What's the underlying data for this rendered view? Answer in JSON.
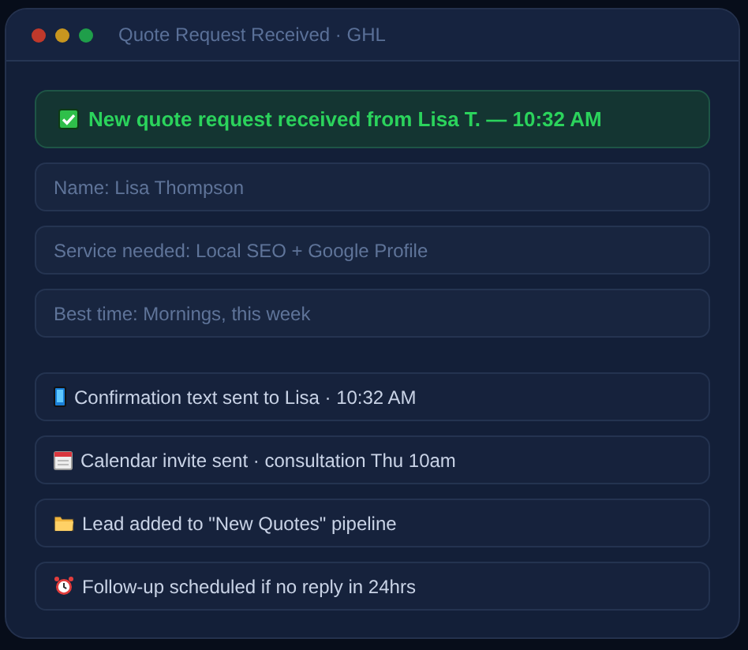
{
  "window": {
    "title": "Quote Request Received · GHL"
  },
  "banner": {
    "text": "New quote request received from Lisa T. — 10:32 AM"
  },
  "fields": [
    {
      "value": "Name: Lisa Thompson"
    },
    {
      "value": "Service needed: Local SEO + Google Profile"
    },
    {
      "value": "Best time: Mornings, this week"
    }
  ],
  "events": [
    {
      "kind": "phone",
      "text": "Confirmation text sent to Lisa · 10:32 AM"
    },
    {
      "kind": "calendar",
      "text": "Calendar invite sent · consultation Thu 10am"
    },
    {
      "kind": "folder",
      "text": "Lead added to \"New Quotes\" pipeline"
    },
    {
      "kind": "alarm",
      "text": "Follow-up scheduled if no reply in 24hrs"
    }
  ]
}
